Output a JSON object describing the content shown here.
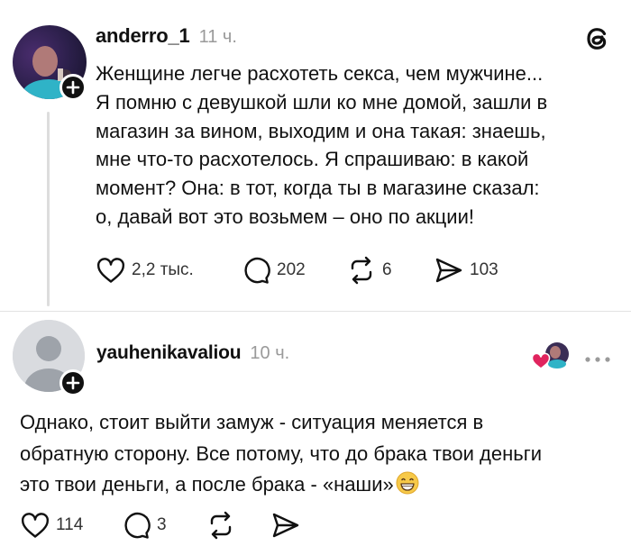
{
  "post1": {
    "username": "anderro_1",
    "time": "11 ч.",
    "lines": [
      "Женщине легче расхотеть секса, чем мужчине...",
      "Я помню с девушкой шли ко мне домой, зашли в",
      "магазин за вином, выходим и она такая: знаешь,",
      "мне что-то расхотелось. Я спрашиваю: в какой",
      "момент? Она: в тот, когда ты в магазине сказал:",
      "о, давай вот это возьмем – оно по акции!"
    ],
    "likes": "2,2 тыс.",
    "replies": "202",
    "reposts": "6",
    "shares": "103"
  },
  "post2": {
    "username": "yauhenikavaliou",
    "time": "10 ч.",
    "lines": [
      "Однако, стоит выйти замуж - ситуация меняется в",
      "обратную сторону. Все потому, что до брака твои деньги",
      "это твои деньги, а после брака - «наши»"
    ],
    "likes": "114",
    "replies": "3"
  },
  "icons": {
    "app_logo": "threads-logo-icon",
    "like": "heart-icon",
    "reply": "comment-icon",
    "repost": "repost-icon",
    "share": "send-icon",
    "more": "more-dots-icon",
    "follow": "plus-icon",
    "emoji": "grinning-face-emoji"
  },
  "colors": {
    "text": "#111111",
    "muted": "#9a9a9a",
    "line": "#dddddd",
    "like_red": "#e0245e",
    "emoji_yellow": "#f7c948"
  }
}
